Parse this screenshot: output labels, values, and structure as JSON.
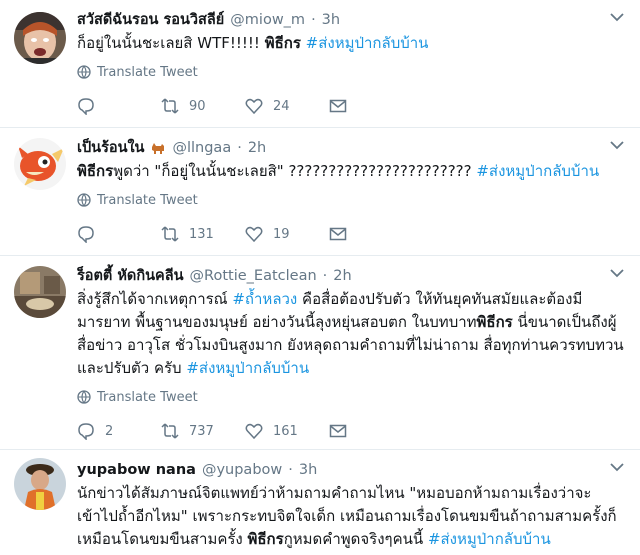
{
  "tweets": [
    {
      "name": "สวัสดีฉันรอน รอนวิสลีย์",
      "handle": "@miow_m",
      "dot": "·",
      "time": "3h",
      "text_parts": {
        "plain1": "ก็อยู่ในนั้นชะเลยสิ WTF!!!!! ",
        "bold1": "พิธีกร",
        "tag1": " #ส่งหมูป่ากลับบ้าน"
      },
      "translate": "Translate Tweet",
      "reply": "",
      "retweet": "90",
      "like": "24"
    },
    {
      "name": "เป็นร้อนใน",
      "handle": "@llngaa",
      "dot": "·",
      "time": "2h",
      "emoji_icon": "dog-emoji",
      "text_parts": {
        "bold1": "พิธีกร",
        "plain1": "พูดว่า \"ก็อยู่ในนั้นชะเลยสิ\" ??????????????????????? ",
        "tag1": "#ส่งหมูป่ากลับบ้าน"
      },
      "translate": "Translate Tweet",
      "reply": "",
      "retweet": "131",
      "like": "19"
    },
    {
      "name": "ร็อตตี้ หัดกินคลีน",
      "handle": "@Rottie_Eatclean",
      "dot": "·",
      "time": "2h",
      "text_parts": {
        "plain1": "สิ่งรู้สึกได้จากเหตุการณ์ ",
        "tag1": "#ถ้ำหลวง",
        "plain2": " คือสื่อต้องปรับตัว ให้ทันยุคทันสมัยและต้องมีมารยาท พื้นฐานของมนุษย์ อย่างวันนี้ลุงหยุ่นสอบตก ในบทบาท",
        "bold1": "พิธีกร",
        "plain3": " นี่ขนาดเป็นถึงผู้สื่อข่าว อาวุโส ชั่วโมงบินสูงมาก ยังหลุดถามคำถามที่ไม่น่าถาม สื่อทุกท่านควรทบทวนและปรับตัว ครับ ",
        "tag2": "#ส่งหมูป่ากลับบ้าน"
      },
      "translate": "Translate Tweet",
      "reply": "2",
      "retweet": "737",
      "like": "161"
    },
    {
      "name": "yupabow nana",
      "handle": "@yupabow",
      "dot": "·",
      "time": "3h",
      "text_parts": {
        "plain1": "นักข่าวได้สัมภาษณ์จิตแพทย์ว่าห้ามถามคำถามไหน \"หมอบอกห้ามถามเรื่องว่าจะเข้าไปถ้ำอีกไหม\" เพราะกระทบจิตใจเด็ก เหมือนถามเรื่องโดนขมขืนถ้าถามสามครั้งก็เหมือนโดนขมขืนสามครั้ง ",
        "bold1": "พิธีกร",
        "plain2": "กูหมดคำพูดจริงๆคนนี้ ",
        "tag1": "#ส่งหมูป่ากลับบ้าน"
      }
    }
  ],
  "icons": {
    "reply": "reply-icon",
    "retweet": "retweet-icon",
    "like": "heart-icon",
    "dm": "envelope-icon",
    "globe": "globe-icon",
    "more": "chevron-down-icon"
  },
  "colors": {
    "hashtag": "#1b95e0",
    "secondary": "#657786",
    "divider": "#e6ecf0"
  }
}
